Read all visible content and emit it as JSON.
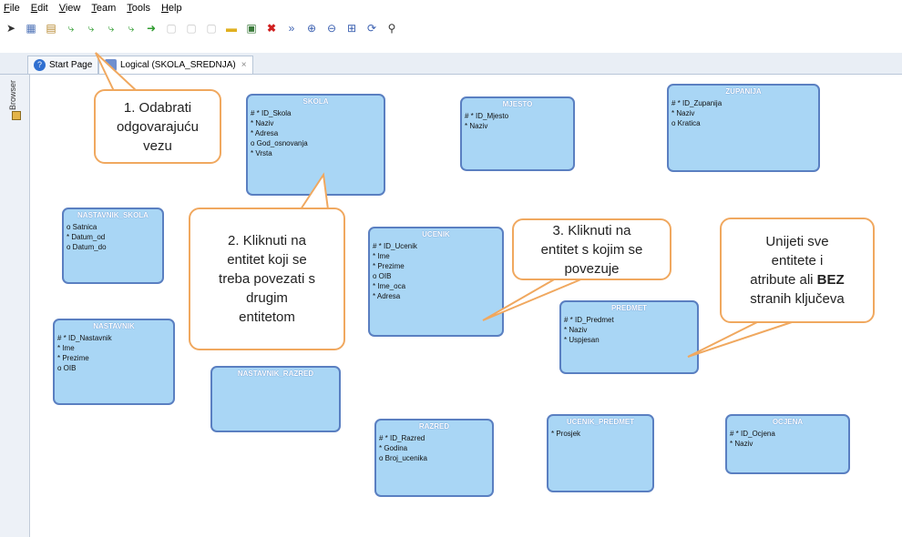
{
  "menu": [
    "File",
    "Edit",
    "View",
    "Team",
    "Tools",
    "Help"
  ],
  "toolbar": {
    "icons": [
      "pointer-icon",
      "new-entity-icon",
      "new-view-icon",
      "relation-1n-icon",
      "relation-11-icon",
      "relation-mn-icon",
      "relation-arc-icon",
      "inheritance-icon",
      "note-icon",
      "note2-icon",
      "note3-icon",
      "folder-icon",
      "save-icon",
      "delete-icon",
      "engineer-icon",
      "zoom-in-icon",
      "zoom-out-icon",
      "fit-icon",
      "layout-icon",
      "find-icon"
    ]
  },
  "tabs": {
    "start_page": "Start Page",
    "logical": "Logical (SKOLA_SREDNJA)"
  },
  "left_panel": {
    "browser_label": "Browser"
  },
  "entities": {
    "skola": {
      "title": "SKOLA",
      "attrs": [
        "# * ID_Skola",
        "* Naziv",
        "* Adresa",
        "o God_osnovanja",
        "* Vrsta"
      ]
    },
    "mjesto": {
      "title": "MJESTO",
      "attrs": [
        "# * ID_Mjesto",
        "* Naziv"
      ]
    },
    "zupanija": {
      "title": "ZUPANIJA",
      "attrs": [
        "# * ID_Zupanija",
        "* Naziv",
        "o Kratica"
      ]
    },
    "nastavnik_skola": {
      "title": "NASTAVNIK_SKOLA",
      "attrs": [
        "o Satnica",
        "* Datum_od",
        "o Datum_do"
      ]
    },
    "ucenik": {
      "title": "UCENIK",
      "attrs": [
        "# * ID_Ucenik",
        "* Ime",
        "* Prezime",
        "o OIB",
        "* Ime_oca",
        "* Adresa"
      ]
    },
    "nastavnik": {
      "title": "NASTAVNIK",
      "attrs": [
        "# * ID_Nastavnik",
        "* Ime",
        "* Prezime",
        "o OIB"
      ]
    },
    "predmet": {
      "title": "PREDMET",
      "attrs": [
        "# * ID_Predmet",
        "* Naziv",
        "* Uspjesan"
      ]
    },
    "nastavnik_razred": {
      "title": "NASTAVNIK_RAZRED",
      "attrs": []
    },
    "razred": {
      "title": "RAZRED",
      "attrs": [
        "# * ID_Razred",
        "* Godina",
        "o Broj_ucenika"
      ]
    },
    "ucenik_predmet": {
      "title": "UCENIK_PREDMET",
      "attrs": [
        "* Prosjek"
      ]
    },
    "ocjena": {
      "title": "OCJENA",
      "attrs": [
        "# * ID_Ocjena",
        "* Naziv"
      ]
    }
  },
  "callouts": {
    "c1": [
      "1. Odabrati",
      "odgovarajuću",
      "vezu"
    ],
    "c2": [
      "2. Kliknuti na",
      "entitet koji se",
      "treba povezati s",
      "drugim",
      "entitetom"
    ],
    "c3": [
      "3. Kliknuti na",
      "entitet s kojim se",
      "povezuje"
    ],
    "c4": [
      "Unijeti sve",
      "entitete i",
      "atribute ali BEZ",
      "stranih ključeva"
    ]
  },
  "colors": {
    "entity_fill": "#a9d6f5",
    "entity_border": "#5a7fc1",
    "callout_border": "#f0a85f"
  }
}
